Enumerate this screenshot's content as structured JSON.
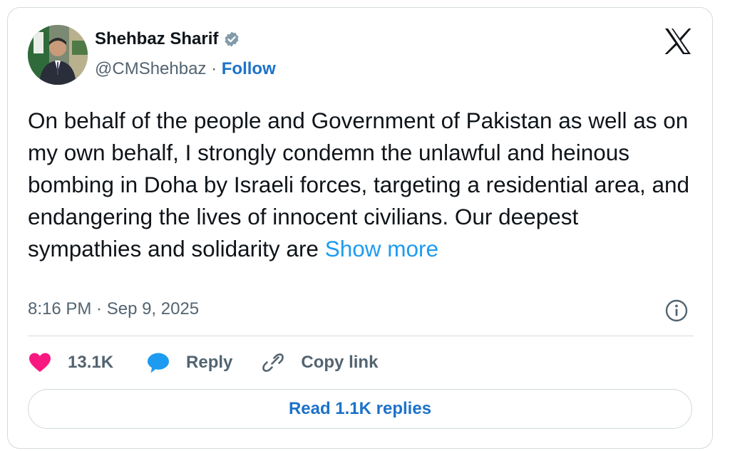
{
  "author": {
    "name": "Shehbaz Sharif",
    "handle": "@CMShehbaz",
    "separator": " · ",
    "follow_label": "Follow",
    "verified_icon": "verified-badge-icon",
    "avatar": "profile-photo"
  },
  "platform_icon": "x-logo-icon",
  "tweet": {
    "text": "On behalf of the people and Government of Pakistan as well as on my own behalf, I strongly condemn the unlawful and heinous bombing in Doha by Israeli forces, targeting a residential area, and endangering the lives of innocent civilians. Our deepest sympathies and solidarity are ",
    "show_more_label": "Show more",
    "timestamp": "8:16 PM · Sep 9, 2025",
    "info_icon": "info-icon"
  },
  "actions": {
    "like_count": "13.1K",
    "reply_label": "Reply",
    "copy_link_label": "Copy link",
    "read_replies_label": "Read 1.1K replies"
  },
  "colors": {
    "link": "#1d9bf0",
    "follow": "#1d72c9",
    "like": "#f91880",
    "secondary_text": "#536471"
  }
}
